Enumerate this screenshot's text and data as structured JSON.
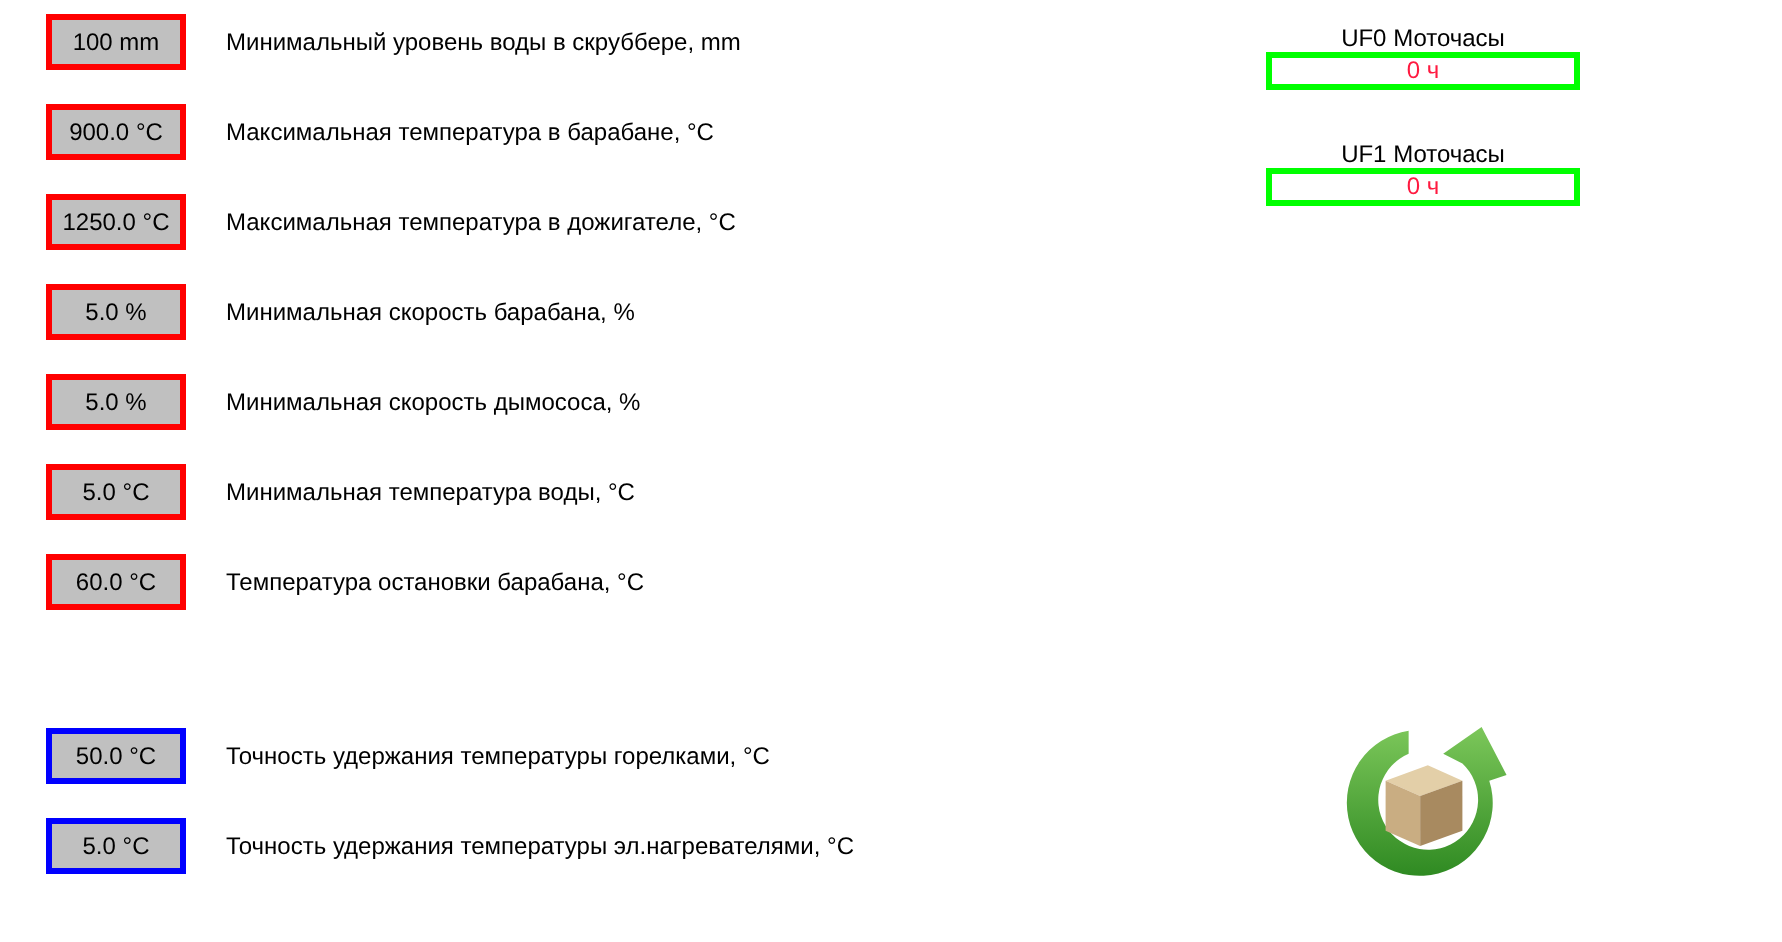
{
  "setting_groups": [
    {
      "settings": [
        {
          "value": "100 mm",
          "label": "Минимальный уровень воды в скруббере, mm",
          "color": "#ff0000"
        },
        {
          "value": "900.0 °C",
          "label": "Максимальная температура в барабане, °C",
          "color": "#ff0000"
        },
        {
          "value": "1250.0 °C",
          "label": "Максимальная температура в дожигателе, °C",
          "color": "#ff0000"
        },
        {
          "value": "5.0 %",
          "label": "Минимальная скорость барабана, %",
          "color": "#ff0000"
        },
        {
          "value": "5.0 %",
          "label": "Минимальная скорость дымососа, %",
          "color": "#ff0000"
        },
        {
          "value": "5.0 °C",
          "label": "Минимальная температура воды, °C",
          "color": "#ff0000"
        },
        {
          "value": "60.0 °C",
          "label": "Температура остановки барабана, °C",
          "color": "#ff0000"
        }
      ]
    },
    {
      "settings": [
        {
          "value": "50.0 °C",
          "label": "Точность удержания температуры горелками, °C",
          "color": "#0000ff"
        },
        {
          "value": "5.0 °C",
          "label": "Точность удержания температуры эл.нагревателями, °C",
          "color": "#0000ff"
        }
      ]
    }
  ],
  "counters": [
    {
      "title": "UF0 Моточасы",
      "value": "0 ч"
    },
    {
      "title": "UF1 Моточасы",
      "value": "0 ч"
    }
  ]
}
